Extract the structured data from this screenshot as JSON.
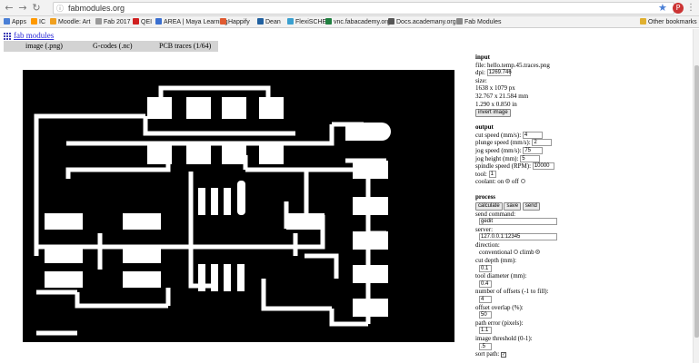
{
  "browser": {
    "url": "fabmodules.org",
    "bookmarks": [
      {
        "label": "Apps",
        "color": "#4a7fd6"
      },
      {
        "label": "IC",
        "color": "#ff9900"
      },
      {
        "label": "Moodle: Art",
        "color": "#f0a020"
      },
      {
        "label": "Fab 2017",
        "color": "#999999"
      },
      {
        "label": "QEI",
        "color": "#d02020"
      },
      {
        "label": "AREA | Maya Learning",
        "color": "#3a6fd0"
      },
      {
        "label": "Happify",
        "color": "#e05a30"
      },
      {
        "label": "Dean",
        "color": "#2060a0"
      },
      {
        "label": "FlexiSCHED",
        "color": "#3aa0d0"
      },
      {
        "label": "vnc.fabacademy.org",
        "color": "#208040"
      },
      {
        "label": "Docs.academany.org",
        "color": "#555555"
      },
      {
        "label": "Fab Modules",
        "color": "#888888"
      },
      {
        "label": "Other bookmarks",
        "color": "#e0b030"
      }
    ]
  },
  "page": {
    "site_link": "fab modules",
    "tabs": [
      "image (.png)",
      "G-codes (.nc)",
      "PCB traces (1/64)"
    ]
  },
  "input": {
    "heading": "input",
    "file": "file: hello.temp.45.traces.png",
    "dpi_label": "dpi:",
    "dpi_value": "1269.746",
    "size_label": "size:",
    "size_px": "1638 x 1079 px",
    "size_mm": "32.767 x 21.584 mm",
    "size_in": "1.290 x 0.850 in",
    "invert_button": "invert image"
  },
  "output": {
    "heading": "output",
    "cut_speed_label": "cut speed (mm/s):",
    "cut_speed": "4",
    "plunge_speed_label": "plunge speed (mm/s):",
    "plunge_speed": "2",
    "jog_speed_label": "jog speed (mm/s):",
    "jog_speed": "75",
    "jog_height_label": "jog height (mm):",
    "jog_height": "5",
    "spindle_speed_label": "spindle speed (RPM):",
    "spindle_speed": "10000",
    "tool_label": "tool:",
    "tool": "1",
    "coolant_label": "coolant: on",
    "coolant_off_label": "off"
  },
  "process": {
    "heading": "process",
    "calculate_button": "calculate",
    "save_button": "save",
    "send_button": "send",
    "send_command_label": "send command:",
    "send_command": "gedit",
    "server_label": "server:",
    "server": "127.0.0.1:12345",
    "direction_label": "direction:",
    "conventional_label": "conventional",
    "climb_label": "climb",
    "cut_depth_label": "cut depth (mm):",
    "cut_depth": "0.1",
    "tool_diameter_label": "tool diameter (mm):",
    "tool_diameter": "0.4",
    "offsets_label": "number of offsets (-1 to fill):",
    "offsets": "4",
    "overlap_label": "offset overlap (%):",
    "overlap": "50",
    "path_error_label": "path error (pixels):",
    "path_error": "1.1",
    "threshold_label": "image threshold (0-1):",
    "threshold": ".5",
    "sort_path_label": "sort path:"
  }
}
